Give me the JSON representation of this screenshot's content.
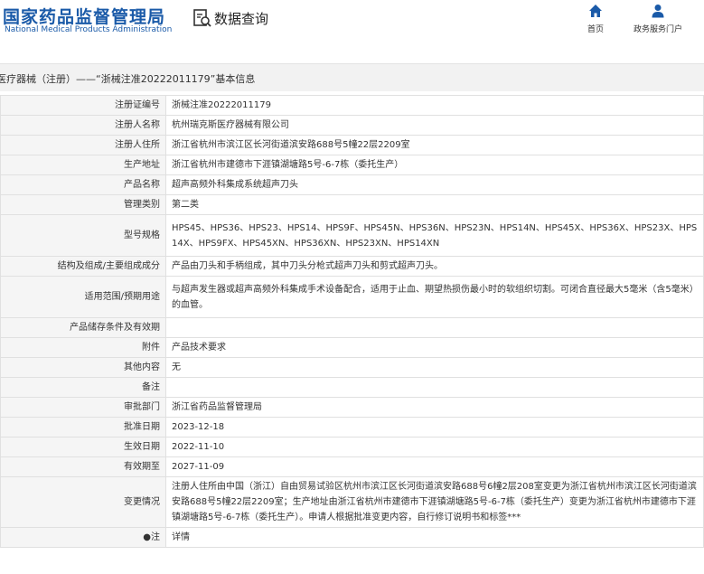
{
  "header": {
    "logo_cn": "国家药品监督管理局",
    "logo_en": "National Medical Products Administration",
    "query_title": "数据查询",
    "nav_home": "首页",
    "nav_service": "政务服务门户"
  },
  "page_title": "医疗器械（注册）——“浙械注准20222011179”基本信息",
  "rows": [
    {
      "k": "注册证编号",
      "v": "浙械注准20222011179"
    },
    {
      "k": "注册人名称",
      "v": "杭州瑞克斯医疗器械有限公司"
    },
    {
      "k": "注册人住所",
      "v": "浙江省杭州市滨江区长河街道滨安路688号5幢22层2209室"
    },
    {
      "k": "生产地址",
      "v": "浙江省杭州市建德市下涯镇湖塘路5号-6-7栋（委托生产）"
    },
    {
      "k": "产品名称",
      "v": "超声高频外科集成系统超声刀头"
    },
    {
      "k": "管理类别",
      "v": "第二类"
    },
    {
      "k": "型号规格",
      "v": "HPS45、HPS36、HPS23、HPS14、HPS9F、HPS45N、HPS36N、HPS23N、HPS14N、HPS45X、HPS36X、HPS23X、HPS14X、HPS9FX、HPS45XN、HPS36XN、HPS23XN、HPS14XN"
    },
    {
      "k": "结构及组成/主要组成成分",
      "v": "产品由刀头和手柄组成，其中刀头分枪式超声刀头和剪式超声刀头。"
    },
    {
      "k": "适用范围/预期用途",
      "v": "与超声发生器或超声高频外科集成手术设备配合，适用于止血、期望热损伤最小时的软组织切割。可闭合直径最大5毫米（含5毫米）的血管。"
    },
    {
      "k": "产品储存条件及有效期",
      "v": ""
    },
    {
      "k": "附件",
      "v": "产品技术要求"
    },
    {
      "k": "其他内容",
      "v": "无"
    },
    {
      "k": "备注",
      "v": ""
    },
    {
      "k": "审批部门",
      "v": "浙江省药品监督管理局"
    },
    {
      "k": "批准日期",
      "v": "2023-12-18"
    },
    {
      "k": "生效日期",
      "v": "2022-11-10"
    },
    {
      "k": "有效期至",
      "v": "2027-11-09"
    },
    {
      "k": "变更情况",
      "v": "注册人住所由中国（浙江）自由贸易试验区杭州市滨江区长河街道滨安路688号6幢2层208室变更为浙江省杭州市滨江区长河街道滨安路688号5幢22层2209室；生产地址由浙江省杭州市建德市下涯镇湖塘路5号-6-7栋（委托生产）变更为浙江省杭州市建德市下涯镇湖塘路5号-6-7栋（委托生产）。申请人根据批准变更内容，自行修订说明书和标签***"
    },
    {
      "k": "●注",
      "v": "详情"
    }
  ],
  "colors": {
    "brand": "#1a5aa8",
    "label_bg": "#f5f5f5",
    "border": "#e0e0e0"
  }
}
